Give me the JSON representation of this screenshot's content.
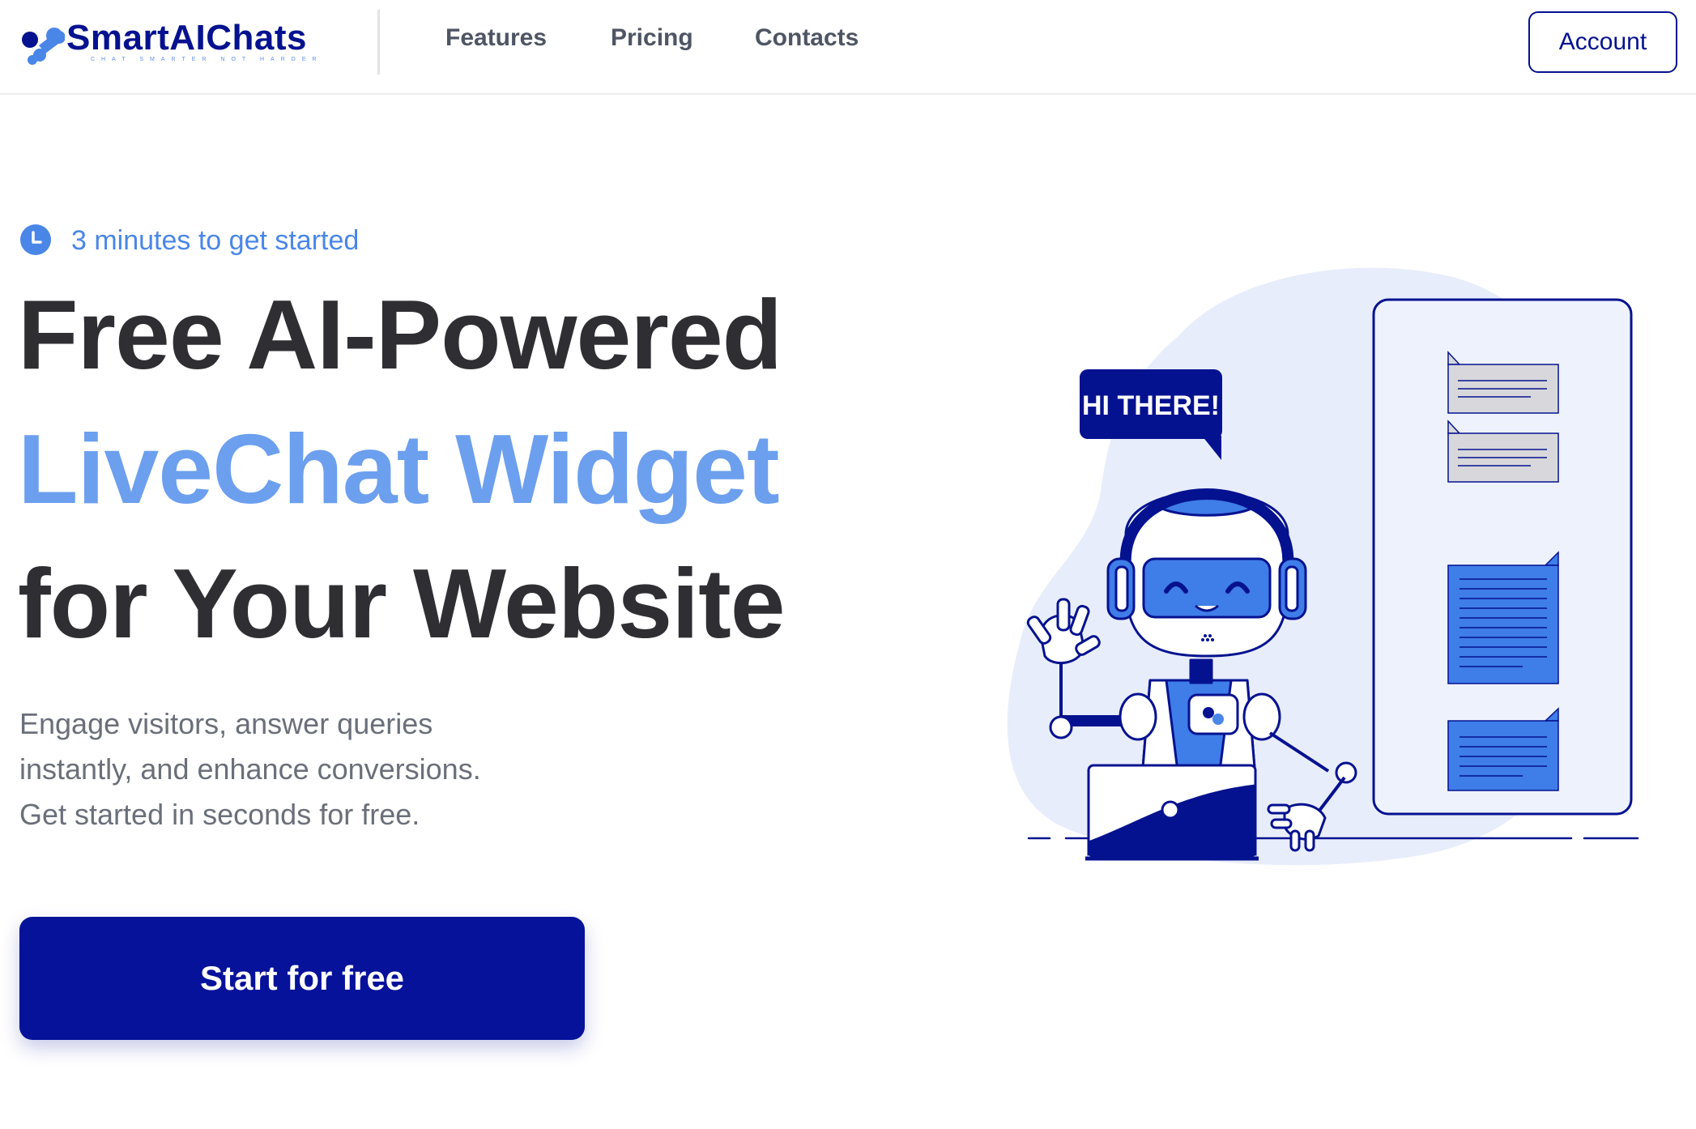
{
  "header": {
    "brand": {
      "name": "SmartAIChats",
      "tagline": "chat smarter not harder"
    },
    "nav": [
      {
        "label": "Features"
      },
      {
        "label": "Pricing"
      },
      {
        "label": "Contacts"
      }
    ],
    "account_label": "Account"
  },
  "hero": {
    "badge": {
      "icon": "clock-icon",
      "text": "3 minutes to get started"
    },
    "headline": {
      "line1": "Free AI-Powered",
      "line2": "LiveChat Widget",
      "line3": "for Your Website"
    },
    "description": "Engage visitors, answer queries instantly, and enhance conversions. Get started in seconds for free.",
    "cta_label": "Start for free"
  },
  "illustration": {
    "speech_bubble": "HI THERE!",
    "icons": [
      "robot-icon",
      "headphones-icon",
      "laptop-icon",
      "chat-panel-icon"
    ]
  },
  "colors": {
    "brand_navy": "#05128f",
    "accent_blue": "#4a86e8",
    "headline_blue": "#6c9fee",
    "blob_light": "#e8edfb"
  }
}
